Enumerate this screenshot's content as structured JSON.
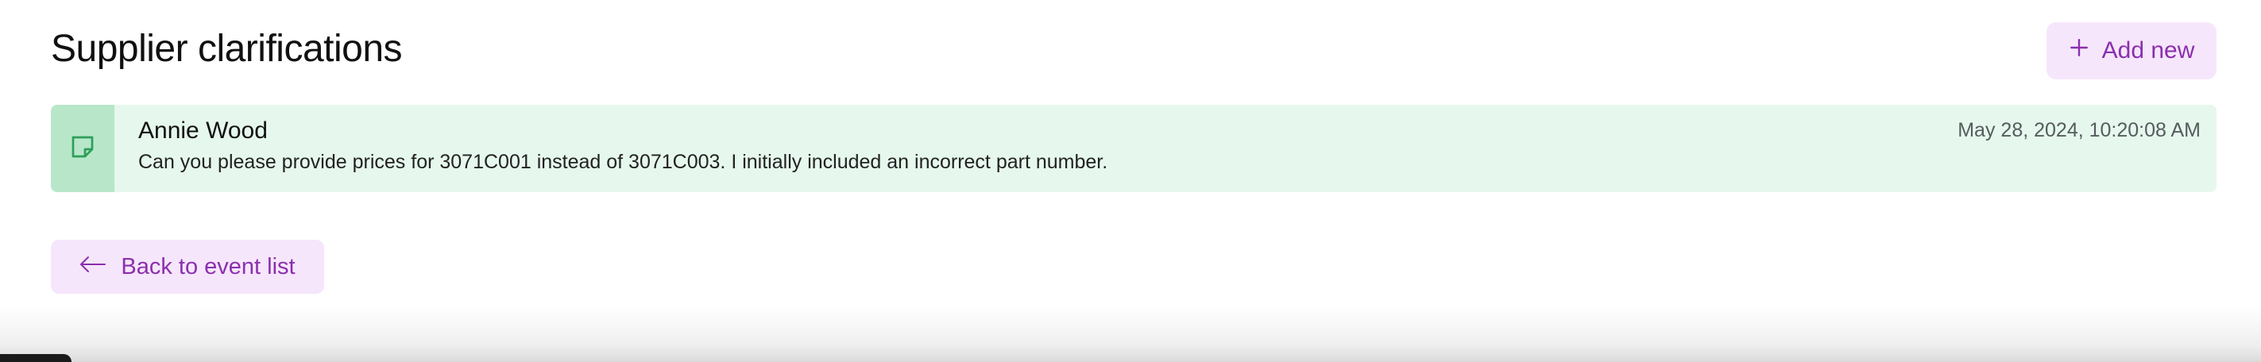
{
  "header": {
    "title": "Supplier clarifications",
    "add_new_label": "Add new",
    "add_new_icon": "plus-icon"
  },
  "clarification": {
    "icon": "sticky-note-icon",
    "author": "Annie Wood",
    "message": "Can you please provide prices for 3071C001 instead of 3071C003. I initially included an incorrect part number.",
    "timestamp": "May 28, 2024, 10:20:08 AM"
  },
  "footer": {
    "back_label": "Back to event list",
    "back_icon": "arrow-left-icon"
  },
  "colors": {
    "accent": "#8b2fae",
    "accent_bg": "#f6e6fb",
    "note_bg": "#e6f8ed",
    "note_icon_bg": "#b7e7c8",
    "note_icon": "#2e9e5b"
  }
}
